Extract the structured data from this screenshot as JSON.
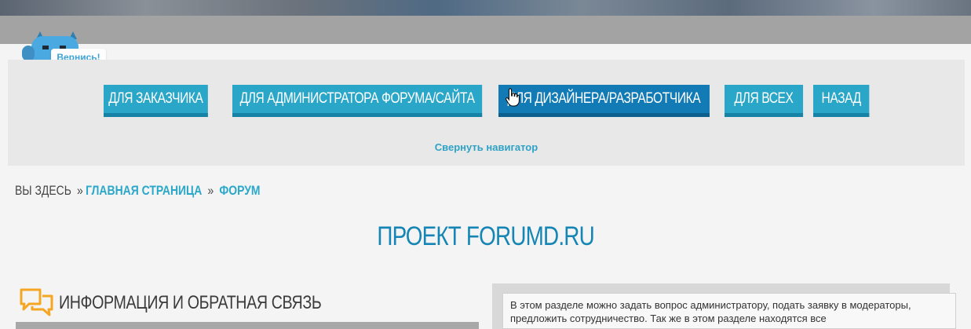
{
  "mascot": {
    "label": "Вернись!"
  },
  "navigator": {
    "buttons": [
      {
        "label": "ДЛЯ ЗАКАЗЧИКА"
      },
      {
        "label": "ДЛЯ АДМИНИСТРАТОРА ФОРУМА/САЙТА"
      },
      {
        "label": "ДЛЯ ДИЗАЙНЕРА/РАЗРАБОТЧИКА"
      },
      {
        "label": "ДЛЯ ВСЕХ"
      },
      {
        "label": "НАЗАД"
      }
    ],
    "collapse_label": "Свернуть навигатор"
  },
  "breadcrumb": {
    "prefix": "ВЫ ЗДЕСЬ",
    "separator": "»",
    "items": [
      {
        "label": "ГЛАВНАЯ СТРАНИЦА"
      },
      {
        "label": "ФОРУМ"
      }
    ]
  },
  "page": {
    "title": "ПРОЕКТ FORUMD.RU"
  },
  "section": {
    "title": "ИНФОРМАЦИЯ И ОБРАТНАЯ СВЯЗЬ",
    "description": "В этом разделе можно задать вопрос администратору, подать заявку в модераторы, предложить сотрудничество. Так же в этом разделе находятся все"
  },
  "colors": {
    "accent": "#29a6c8",
    "accent_active": "#127ab4",
    "title": "#1585b5",
    "chat_icon": "#f5a623"
  },
  "icons": {
    "section": "chat-bubbles-icon",
    "cursor": "hand-pointer-icon",
    "mascot": "mascot-icon"
  }
}
